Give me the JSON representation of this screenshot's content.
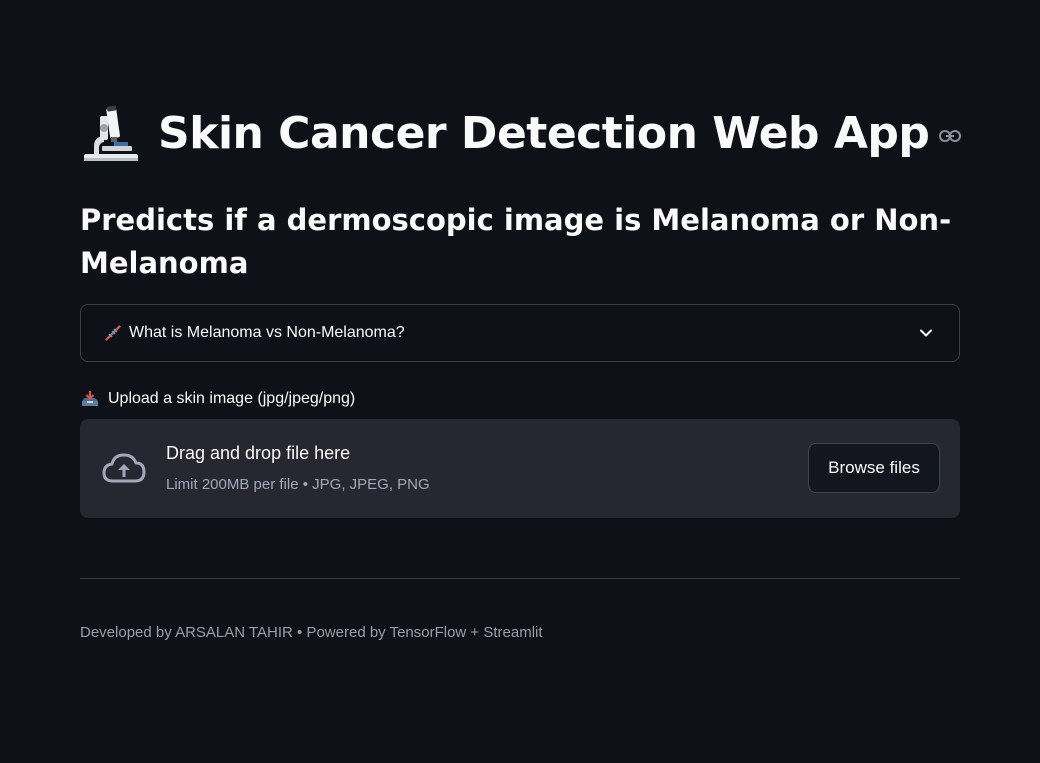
{
  "header": {
    "title": "Skin Cancer Detection Web App",
    "title_icon": "microscope-icon",
    "anchor_icon": "link-icon"
  },
  "subtitle": "Predicts if a dermoscopic image is Melanoma or Non-Melanoma",
  "expander": {
    "icon": "dna-icon",
    "label": "What is Melanoma vs Non-Melanoma?",
    "expanded": false
  },
  "uploader": {
    "label_icon": "inbox-tray-icon",
    "label": "Upload a skin image (jpg/jpeg/png)",
    "drop_title": "Drag and drop file here",
    "drop_subtitle": "Limit 200MB per file • JPG, JPEG, PNG",
    "browse_label": "Browse files"
  },
  "footer": {
    "text": "Developed by ARSALAN TAHIR • Powered by TensorFlow + Streamlit"
  },
  "colors": {
    "background": "#0e1117",
    "dropzone": "#262730",
    "text": "#fafafa",
    "muted": "#a3a8b8"
  }
}
